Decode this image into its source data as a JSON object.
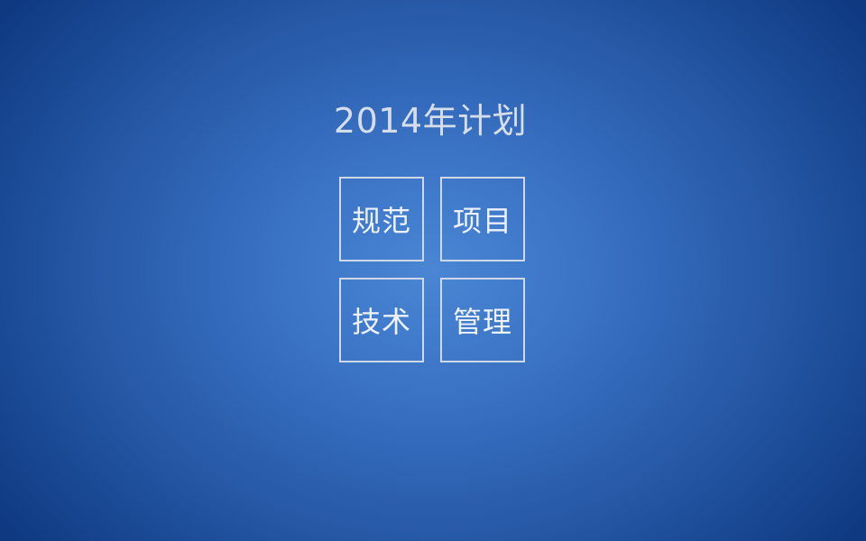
{
  "slide": {
    "title": "2014年计划",
    "tiles": [
      {
        "label": "规范"
      },
      {
        "label": "项目"
      },
      {
        "label": "技术"
      },
      {
        "label": "管理"
      }
    ]
  },
  "colors": {
    "background_center": "#4a86d4",
    "background_edge": "#0f3a82",
    "title_text": "#d5dde9",
    "tile_border": "#cfd8e6",
    "tile_text": "#eef2f8"
  }
}
